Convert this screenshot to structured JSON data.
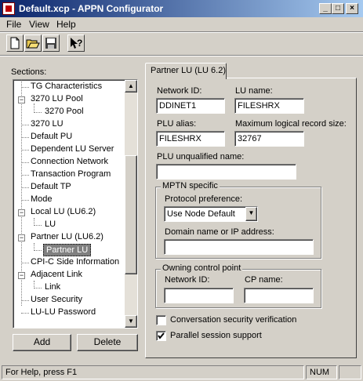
{
  "window": {
    "title": "Default.xcp - APPN Configurator"
  },
  "menu": {
    "file": "File",
    "view": "View",
    "help": "Help"
  },
  "toolbar": {
    "new": "new-document-icon",
    "open": "open-folder-icon",
    "save": "save-disk-icon",
    "help": "context-help-icon"
  },
  "sections": {
    "label": "Sections:",
    "items": [
      "TG Characteristics",
      "3270 LU Pool",
      "3270 Pool",
      "3270 LU",
      "Default PU",
      "Dependent LU Server",
      "Connection Network",
      "Transaction Program",
      "Default TP",
      "Mode",
      "Local LU (LU6.2)",
      "LU",
      "Partner LU (LU6.2)",
      "Partner LU",
      "CPI-C Side Information",
      "Adjacent Link",
      "Link",
      "User Security",
      "LU-LU Password"
    ],
    "add_button": "Add",
    "delete_button": "Delete"
  },
  "tab": {
    "label": "Partner LU (LU 6.2)"
  },
  "form": {
    "network_id_label": "Network ID:",
    "network_id_value": "DDINET1",
    "lu_name_label": "LU name:",
    "lu_name_value": "FILESHRX",
    "plu_alias_label": "PLU alias:",
    "plu_alias_value": "FILESHRX",
    "max_record_label": "Maximum logical record size:",
    "max_record_value": "32767",
    "plu_unqualified_label": "PLU unqualified name:",
    "plu_unqualified_value": "",
    "mptn_title": "MPTN specific",
    "protocol_label": "Protocol preference:",
    "protocol_value": "Use Node Default",
    "domain_label": "Domain name or IP address:",
    "domain_value": "",
    "owning_title": "Owning control point",
    "owning_network_label": "Network ID:",
    "owning_network_value": "",
    "cp_name_label": "CP name:",
    "cp_name_value": "",
    "conv_security_label": "Conversation security verification",
    "conv_security_checked": false,
    "parallel_session_label": "Parallel session support",
    "parallel_session_checked": true
  },
  "status": {
    "help_text": "For Help, press F1",
    "num": "NUM"
  }
}
